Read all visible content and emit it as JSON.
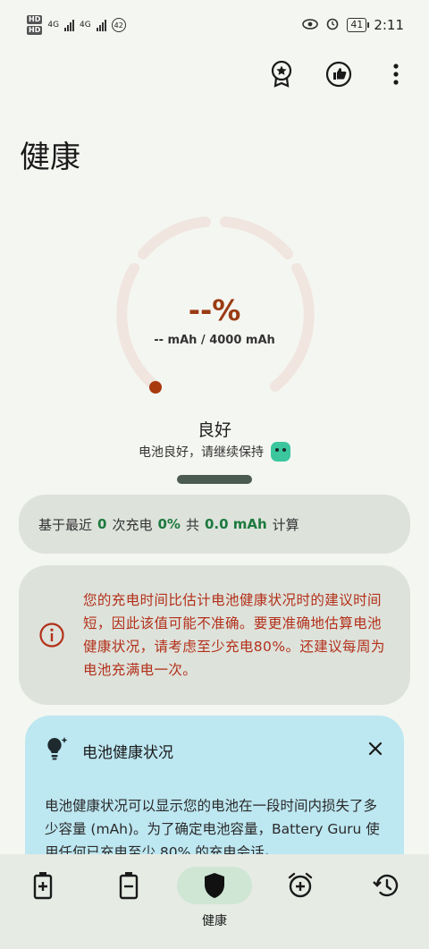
{
  "status_bar": {
    "hd1": "HD",
    "hd2": "HD",
    "net1": "4G",
    "net2": "4G",
    "notif_count": "42",
    "battery": "41",
    "time": "2:11"
  },
  "page": {
    "title": "健康"
  },
  "gauge": {
    "percent_text": "--%",
    "capacity_text": "-- mAh / 4000 mAh",
    "progress_fraction": 0
  },
  "health": {
    "status": "良好",
    "subtitle": "电池良好，请继续保持"
  },
  "summary": {
    "prefix": "基于最近",
    "charges": "0",
    "charges_unit": "次充电",
    "percent": "0%",
    "mid": "共",
    "mah": "0.0 mAh",
    "suffix": "计算"
  },
  "warning": {
    "text": "您的充电时间比估计电池健康状况时的建议时间短，因此该值可能不准确。要更准确地估算电池健康状况，请考虑至少充电80%。还建议每周为电池充满电一次。"
  },
  "info_card": {
    "title": "电池健康状况",
    "body": "电池健康状况可以显示您的电池在一段时间内损失了多少容量 (mAh)。为了确定电池容量，Battery Guru 使用任何已充电至少 80% 的充电会话。"
  },
  "bottom_nav": {
    "active_label": "健康"
  },
  "colors": {
    "accent_rust": "#9a3b13",
    "success_green": "#1d7a3e",
    "warning_red": "#b3301a",
    "info_bg": "#bde7f1"
  }
}
